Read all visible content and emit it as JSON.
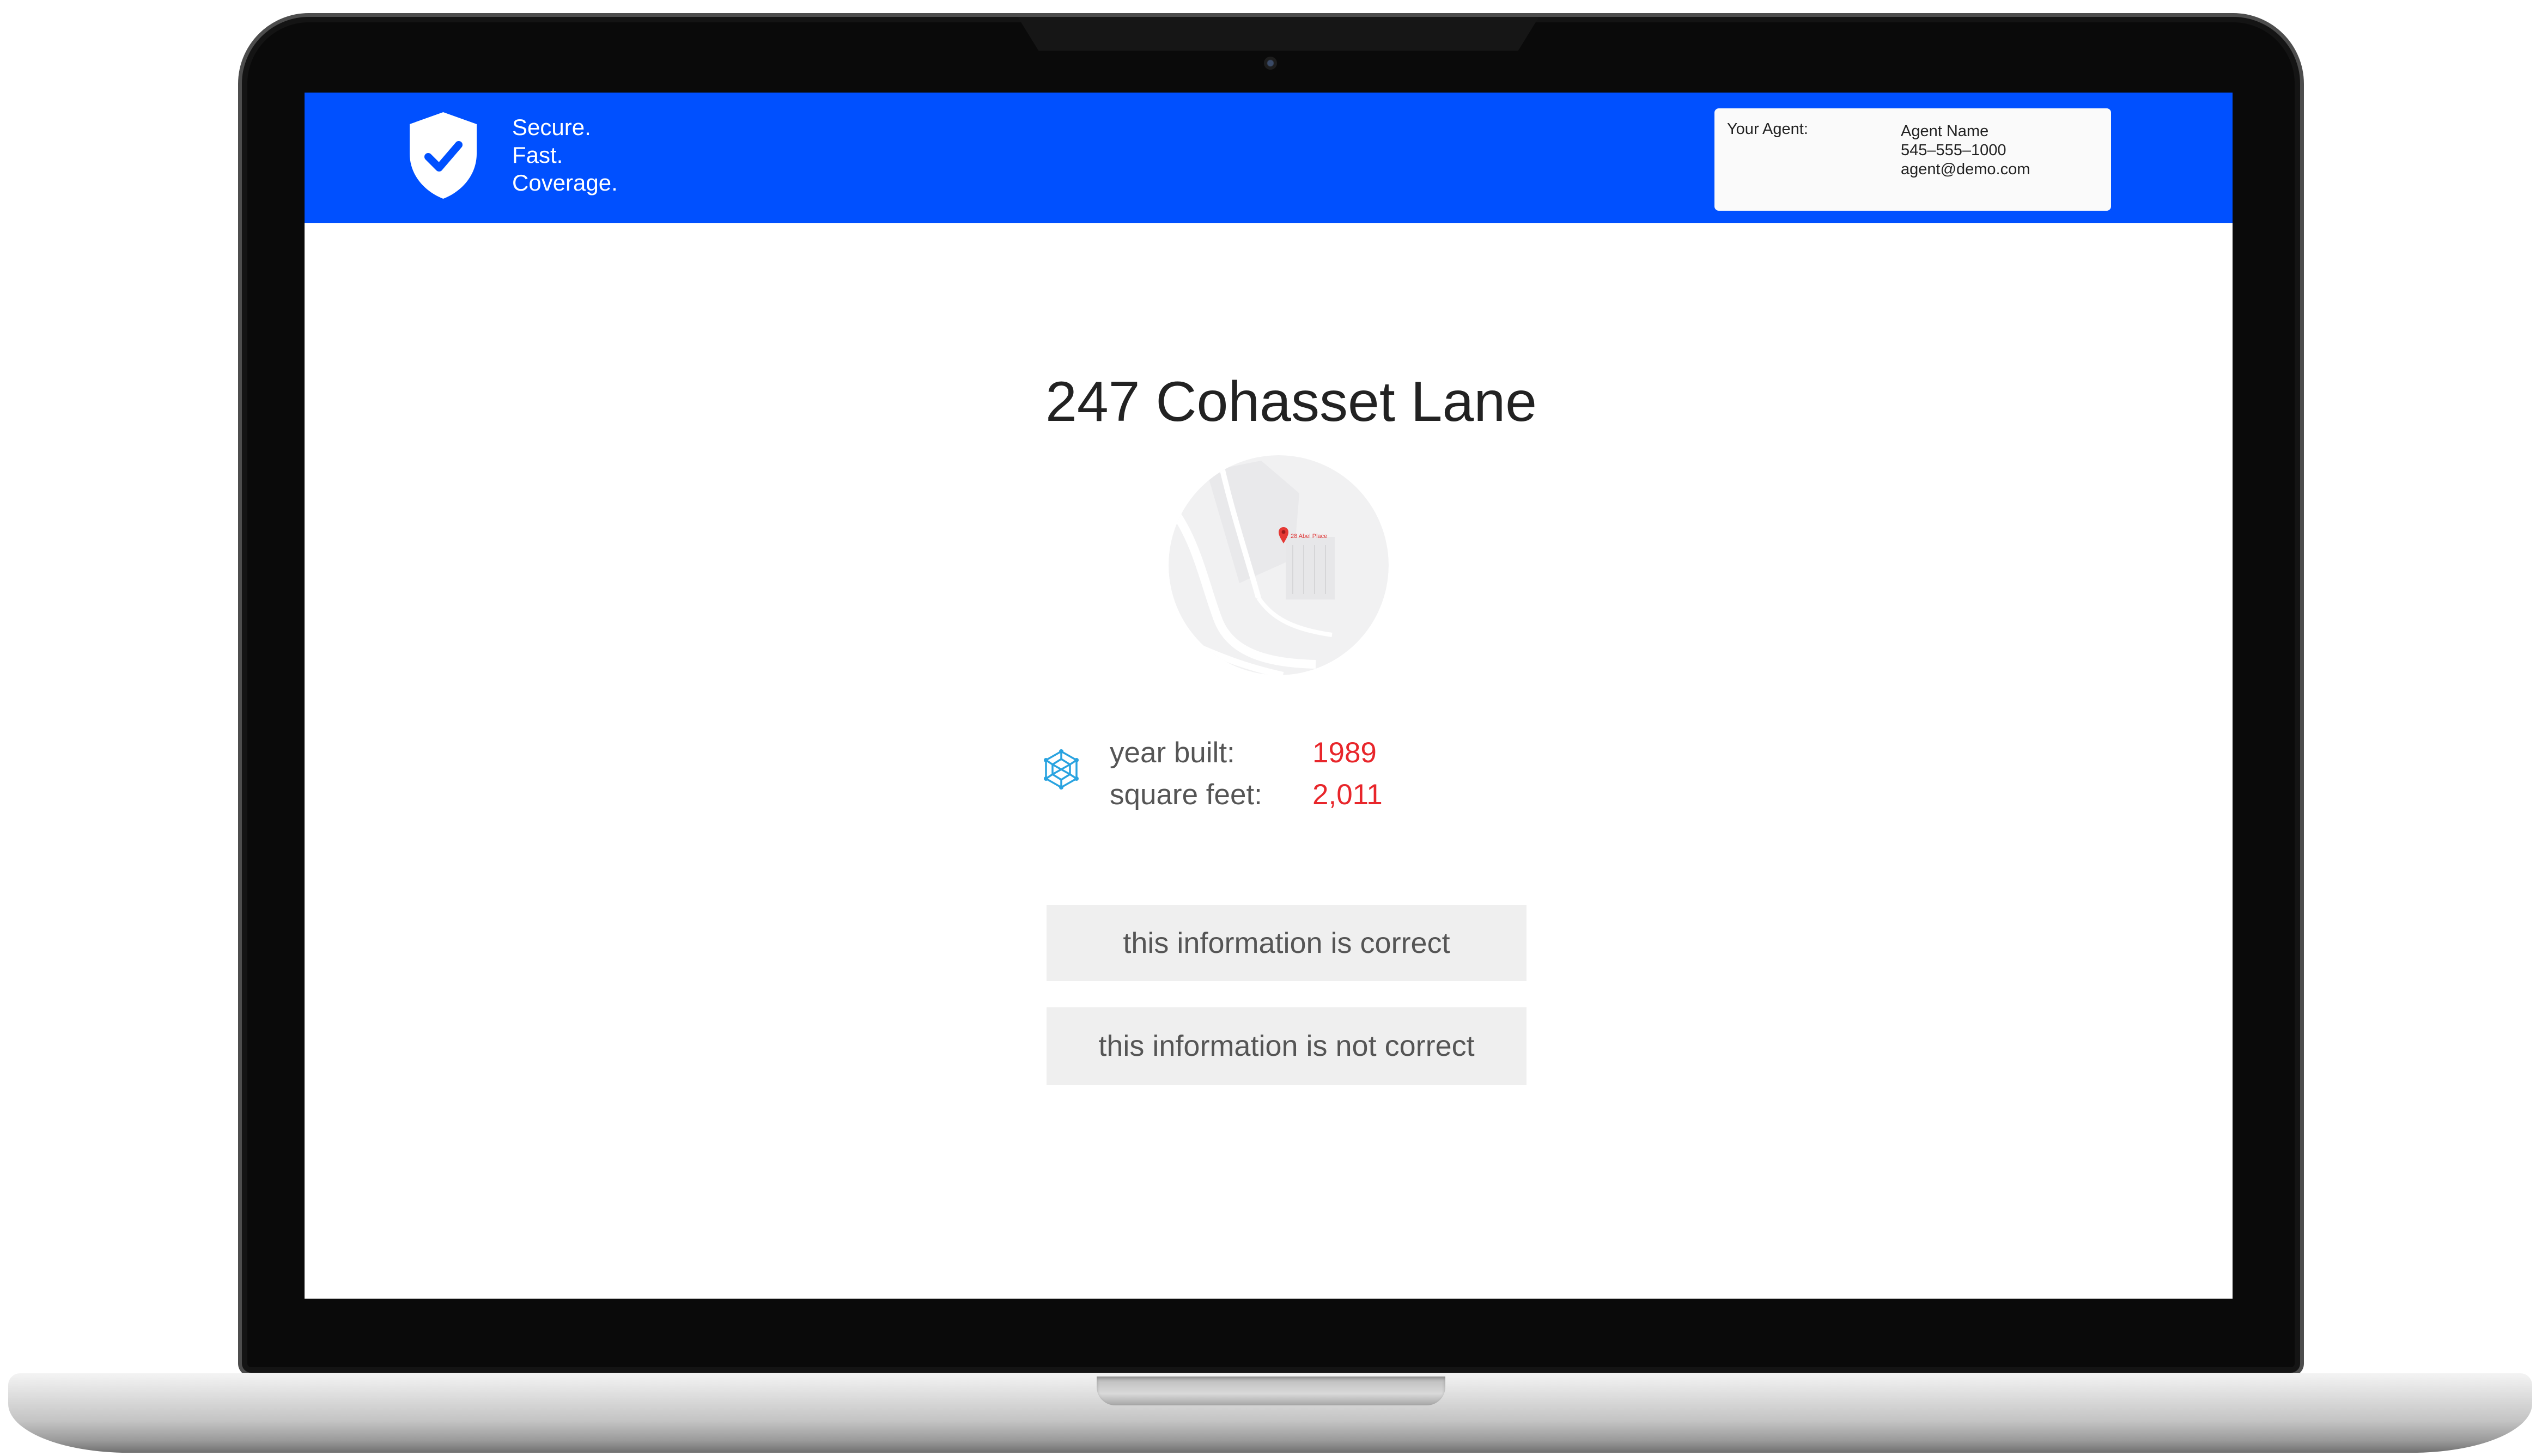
{
  "header": {
    "tagline": [
      "Secure.",
      "Fast.",
      "Coverage."
    ],
    "agent": {
      "label": "Your Agent:",
      "name": "Agent Name",
      "phone": "545–555–1000",
      "email": "agent@demo.com"
    }
  },
  "property": {
    "address": "247 Cohasset Lane",
    "map_pin_label": "28 Abel Place",
    "details": [
      {
        "label": "year built:",
        "value": "1989"
      },
      {
        "label": "square feet:",
        "value": "2,011"
      }
    ]
  },
  "actions": {
    "correct_label": "this information is correct",
    "incorrect_label": "this information is not correct"
  },
  "icons": {
    "logo": "shield-check-icon",
    "details": "network-icon",
    "map_pin": "map-pin-icon"
  },
  "colors": {
    "brand_blue": "#0050FF",
    "value_red": "#E8262B",
    "icon_blue": "#29A3E0",
    "button_bg": "#EFEFEF"
  }
}
